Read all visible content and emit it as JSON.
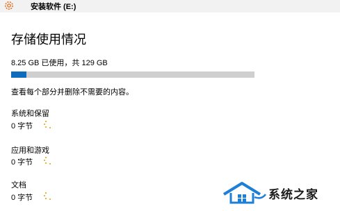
{
  "header": {
    "drive_title": "安装软件 (E:)"
  },
  "page_title": "存储使用情况",
  "usage": {
    "text": "8.25 GB 已使用，共 129 GB",
    "used_fraction": 0.064
  },
  "description": "查看每个部分并删除不需要的内容。",
  "categories": [
    {
      "label": "系统和保留",
      "value": "0 字节"
    },
    {
      "label": "应用和游戏",
      "value": "0 字节"
    },
    {
      "label": "文档",
      "value": "0 字节"
    }
  ],
  "watermark": {
    "text": "系统之家"
  },
  "colors": {
    "accent": "#0f6cbd",
    "bar_bg": "#cfcfcf",
    "gear": "#e07a2f",
    "spinner": "#e0a000"
  },
  "icons": {
    "settings": "gear-icon",
    "loading": "loading-spinner-icon",
    "logo": "house-logo-icon"
  }
}
